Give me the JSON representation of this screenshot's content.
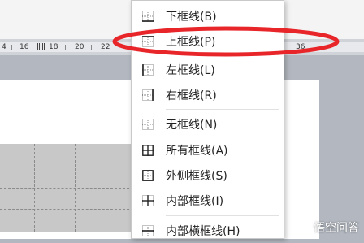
{
  "ruler": {
    "labels": [
      "4",
      "16",
      "18",
      "20",
      "22",
      "36"
    ]
  },
  "menu": {
    "items": [
      {
        "label": "下框线(B)",
        "icon": "border-bottom-icon"
      },
      {
        "label": "上框线(P)",
        "icon": "border-top-icon"
      },
      {
        "label": "左框线(L)",
        "icon": "border-left-icon"
      },
      {
        "label": "右框线(R)",
        "icon": "border-right-icon"
      },
      {
        "label": "无框线(N)",
        "icon": "border-none-icon"
      },
      {
        "label": "所有框线(A)",
        "icon": "border-all-icon"
      },
      {
        "label": "外侧框线(S)",
        "icon": "border-outside-icon"
      },
      {
        "label": "内部框线(I)",
        "icon": "border-inside-icon"
      },
      {
        "label": "内部横框线(H)",
        "icon": "border-inside-horizontal-icon"
      }
    ],
    "highlighted_item": "上框线(P)"
  },
  "annotation": {
    "color": "#e8262a"
  },
  "watermark": {
    "text": "悟空问答"
  }
}
